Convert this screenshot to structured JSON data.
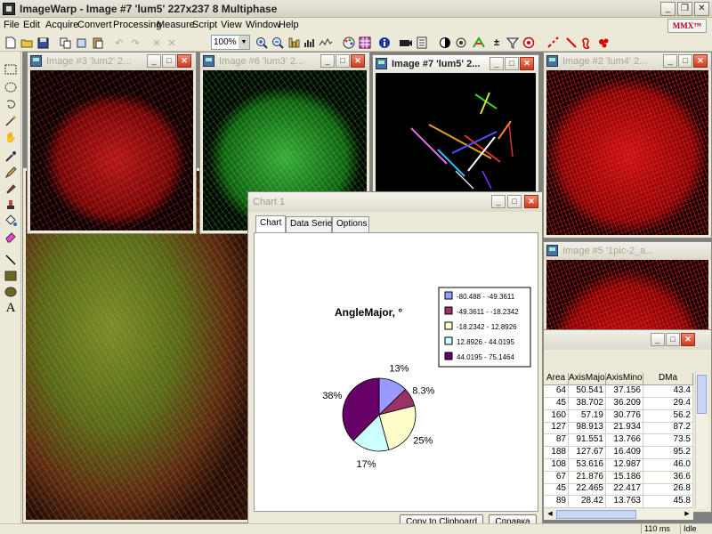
{
  "app": {
    "title": "ImageWarp - Image #7  'lum5'  227x237  8 Multiphase",
    "logo_text": "MMX™"
  },
  "menu": [
    "File",
    "Edit",
    "Acquire",
    "Convert",
    "Processing",
    "Measure",
    "Script",
    "View",
    "Window",
    "Help"
  ],
  "toolbar": {
    "zoom_value": "100%",
    "icons": [
      "new-icon",
      "open-icon",
      "save-icon",
      "copy-icon",
      "cut-icon",
      "paste-icon",
      "undo-icon",
      "redo-icon",
      "zoom-in-icon",
      "zoom-out-icon",
      "measure-icon",
      "histogram-icon",
      "profile-icon",
      "palette-icon",
      "grid-icon",
      "info-icon",
      "camera-icon",
      "macro-icon",
      "contrast-icon",
      "morphology-icon",
      "plus-minus-icon",
      "filter-icon",
      "target-icon",
      "line-tool-icon",
      "curve-tool-icon",
      "blob-tool-icon"
    ]
  },
  "palette": [
    "rectangle-select-icon",
    "ellipse-select-icon",
    "lasso-icon",
    "magic-wand-icon",
    "hand-icon",
    "eyedropper-icon",
    "pencil-icon",
    "brush-icon",
    "stamp-icon",
    "fill-icon",
    "eraser-icon",
    "line-icon",
    "filled-rectangle-icon",
    "filled-ellipse-icon",
    "text-icon"
  ],
  "windows": [
    {
      "title": "Image #3  'lum2'  2..."
    },
    {
      "title": "Image #6  'lum3'  2..."
    },
    {
      "title": "Image #7  'lum5'  2..."
    },
    {
      "title": "Image #2  'lum4'  2..."
    },
    {
      "title": "Image #5  '1pic-2_a..."
    }
  ],
  "chart_window": {
    "title": "Chart 1",
    "tabs": [
      "Chart",
      "Data Series",
      "Options"
    ],
    "copy_button": "Copy to Clipboard",
    "help_button": "Справка"
  },
  "chart_data": {
    "type": "pie",
    "title": "AngleMajor, °",
    "legend_position": "top-right",
    "categories": [
      "-80.488 - -49.3611",
      "-49.3611 - -18.2342",
      "-18.2342 - 12.8926",
      "12.8926 - 44.0195",
      "44.0195 - 75.1464"
    ],
    "values": [
      13,
      8.3,
      25,
      17,
      38
    ],
    "labels": [
      "13%",
      "8.3%",
      "25%",
      "17%",
      "38%"
    ],
    "colors": [
      "#9999ff",
      "#993366",
      "#ffffcc",
      "#ccffff",
      "#660066"
    ]
  },
  "table": {
    "headers": [
      "Area",
      "AxisMajor",
      "AxisMinor",
      "DMa"
    ],
    "rows": [
      [
        "64",
        "50.541",
        "37.156",
        "43.4"
      ],
      [
        "45",
        "38.702",
        "36.209",
        "29.4"
      ],
      [
        "160",
        "57.19",
        "30.776",
        "56.2"
      ],
      [
        "127",
        "98.913",
        "21.934",
        "87.2"
      ],
      [
        "87",
        "91.551",
        "13.766",
        "73.5"
      ],
      [
        "188",
        "127.67",
        "16.409",
        "95.2"
      ],
      [
        "108",
        "53.616",
        "12.987",
        "46.0"
      ],
      [
        "67",
        "21.876",
        "15.186",
        "36.6"
      ],
      [
        "45",
        "22.465",
        "22.417",
        "26.8"
      ],
      [
        "89",
        "28.42",
        "13.763",
        "45.8"
      ]
    ]
  },
  "status": {
    "time": "110 ms",
    "state": "Idle"
  }
}
